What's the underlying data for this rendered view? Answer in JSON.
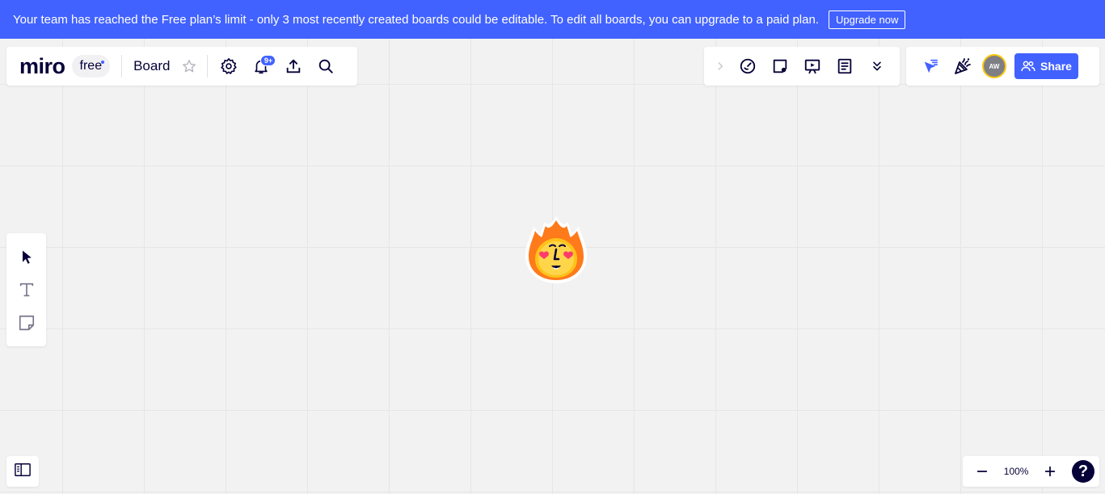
{
  "banner": {
    "message": "Your team has reached the Free plan’s limit - only 3 most recently created boards could be editable. To edit all boards, you can upgrade to a paid plan.",
    "upgrade_label": "Upgrade now",
    "background": "#4262ff"
  },
  "header": {
    "logo": "miro",
    "plan": "free",
    "board_name": "Board",
    "notifications_badge": "9+",
    "icons": [
      "star-icon",
      "settings-icon",
      "bell-icon",
      "upload-icon",
      "search-icon"
    ]
  },
  "tools_panel": {
    "icons": [
      "chevron-right-icon",
      "timer-icon",
      "card-icon",
      "presentation-icon",
      "notes-icon",
      "double-chevron-down-icon"
    ]
  },
  "share_panel": {
    "avatar_initials": "AW",
    "share_label": "Share",
    "accent": "#4262ff",
    "icons": [
      "cursor-filter-icon",
      "celebrate-icon"
    ]
  },
  "left_toolbar": {
    "tools": [
      "select-icon",
      "text-icon",
      "sticky-note-icon"
    ]
  },
  "zoom": {
    "level": "100%",
    "help": "?"
  }
}
